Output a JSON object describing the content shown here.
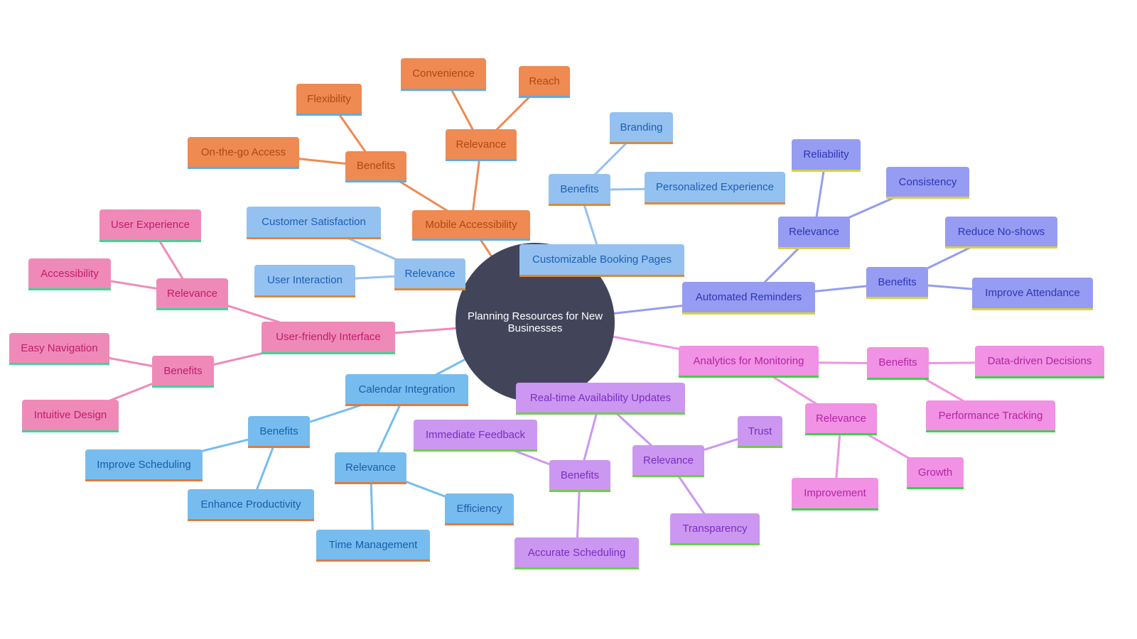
{
  "diagram": {
    "type": "mindmap",
    "root": "Planning Resources for New Businesses",
    "colors": {
      "center": "#42455a",
      "mobile_accessibility": "#ee8a52",
      "customizable_booking_pages": "#94c1f0",
      "calendar_integration": "#76bcef",
      "automated_reminders": "#959cf2",
      "user_friendly_interface": "#ef8ab8",
      "realtime_updates": "#cc97f0",
      "analytics": "#f192e4"
    },
    "nodes": {
      "mobile": "Mobile Accessibility",
      "mobile_benefits": "Benefits",
      "mobile_flexibility": "Flexibility",
      "mobile_onthego": "On-the-go Access",
      "mobile_relevance": "Relevance",
      "mobile_convenience": "Convenience",
      "mobile_reach": "Reach",
      "booking": "Customizable Booking Pages",
      "booking_benefits": "Benefits",
      "booking_branding": "Branding",
      "booking_personalized": "Personalized Experience",
      "booking_relevance": "Relevance",
      "booking_satisfaction": "Customer Satisfaction",
      "booking_interaction": "User Interaction",
      "reminders": "Automated Reminders",
      "reminders_relevance": "Relevance",
      "reminders_reliability": "Reliability",
      "reminders_consistency": "Consistency",
      "reminders_benefits": "Benefits",
      "reminders_noshows": "Reduce No-shows",
      "reminders_attendance": "Improve Attendance",
      "ui": "User-friendly Interface",
      "ui_relevance": "Relevance",
      "ui_experience": "User Experience",
      "ui_accessibility": "Accessibility",
      "ui_benefits": "Benefits",
      "ui_navigation": "Easy Navigation",
      "ui_intuitive": "Intuitive Design",
      "calendar": "Calendar Integration",
      "calendar_benefits": "Benefits",
      "calendar_scheduling": "Improve Scheduling",
      "calendar_productivity": "Enhance Productivity",
      "calendar_relevance": "Relevance",
      "calendar_time": "Time Management",
      "calendar_efficiency": "Efficiency",
      "realtime": "Real-time Availability Updates",
      "realtime_benefits": "Benefits",
      "realtime_feedback": "Immediate Feedback",
      "realtime_accurate": "Accurate Scheduling",
      "realtime_relevance": "Relevance",
      "realtime_trust": "Trust",
      "realtime_transparency": "Transparency",
      "analytics": "Analytics for Monitoring",
      "analytics_benefits": "Benefits",
      "analytics_decisions": "Data-driven Decisions",
      "analytics_tracking": "Performance Tracking",
      "analytics_relevance": "Relevance",
      "analytics_improvement": "Improvement",
      "analytics_growth": "Growth"
    }
  }
}
